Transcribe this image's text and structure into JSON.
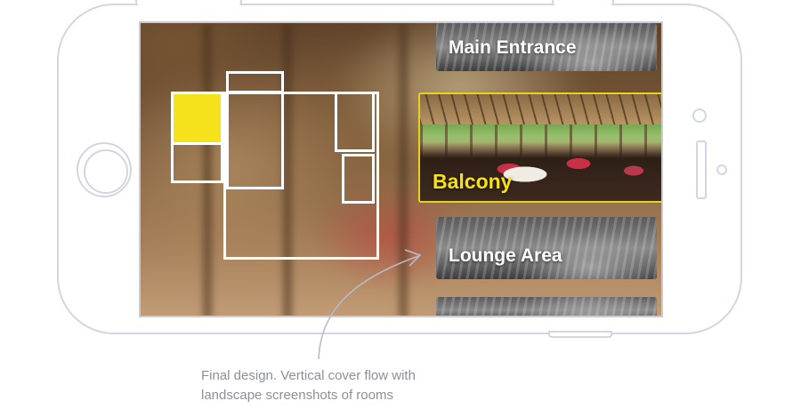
{
  "rooms_list": [
    {
      "label": "Main Entrance",
      "selected": false
    },
    {
      "label": "Balcony",
      "selected": true
    },
    {
      "label": "Lounge Area",
      "selected": false
    },
    {
      "label": "",
      "selected": false
    }
  ],
  "floor_plan": {
    "highlight_color": "#f5e11c",
    "outline_color": "#ffffff"
  },
  "caption": {
    "line1": "Final design. Vertical cover flow with",
    "line2": "landscape screenshots of rooms"
  },
  "colors": {
    "frame": "#d3d6e2",
    "caption": "#8c8f99",
    "selected_label": "#f5e11c"
  }
}
